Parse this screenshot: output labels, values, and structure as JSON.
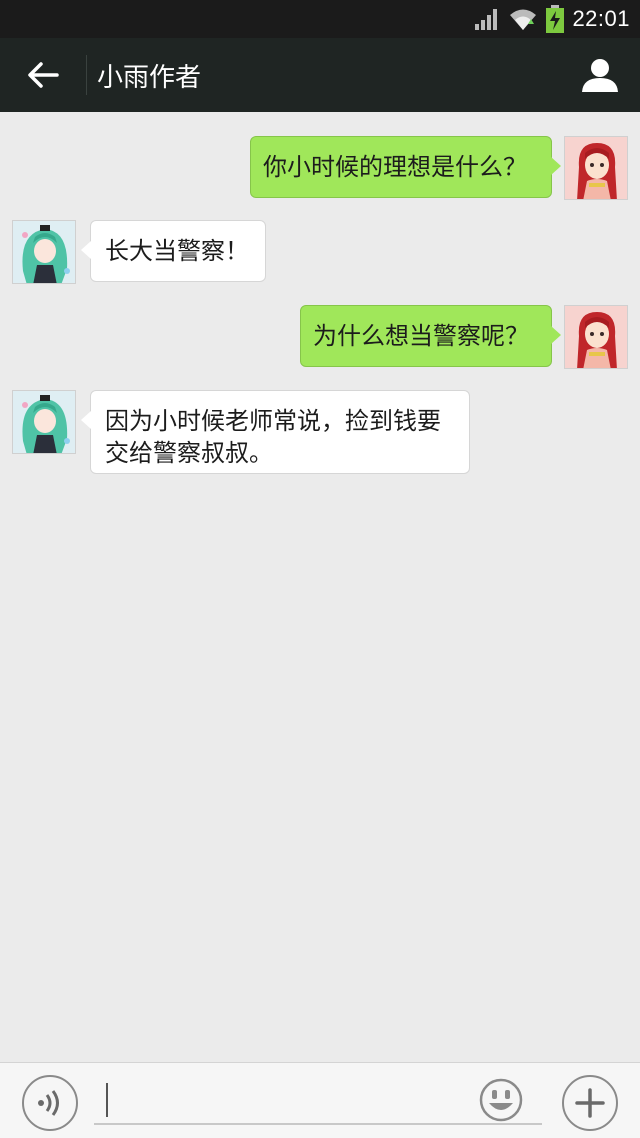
{
  "status_bar": {
    "time": "22:01"
  },
  "header": {
    "title": "小雨作者"
  },
  "messages": [
    {
      "side": "right",
      "text": "你小时候的理想是什么？"
    },
    {
      "side": "left",
      "text": "长大当警察！"
    },
    {
      "side": "right",
      "text": "为什么想当警察呢？"
    },
    {
      "side": "left",
      "text": "因为小时候老师常说，捡到钱要交给警察叔叔。"
    }
  ],
  "input": {
    "value": ""
  },
  "colors": {
    "title_bar": "#1f2523",
    "sent_bubble": "#a0e75a",
    "received_bubble": "#ffffff",
    "chat_bg": "#ebebeb"
  },
  "icons": [
    "signal-icon",
    "wifi-icon",
    "battery-icon",
    "back-arrow-icon",
    "profile-icon",
    "voice-icon",
    "emoji-icon",
    "plus-icon"
  ]
}
